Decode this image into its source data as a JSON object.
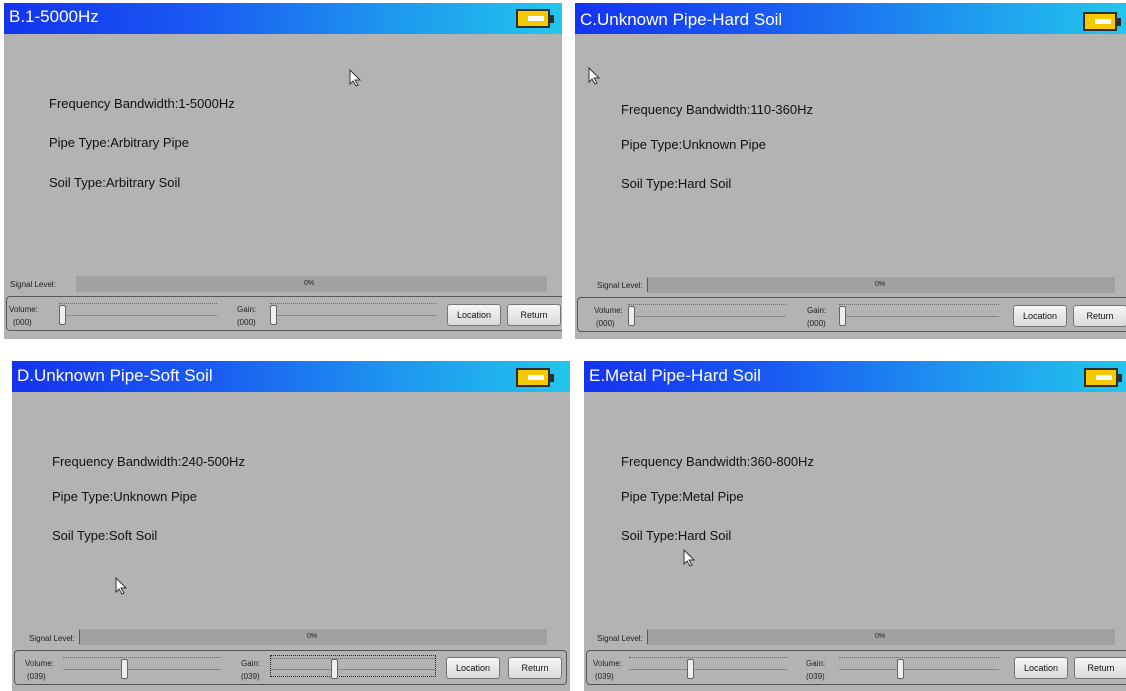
{
  "panels": [
    {
      "title": "B.1-5000Hz",
      "freq": "Frequency Bandwidth:1-5000Hz",
      "pipe": "Pipe Type:Arbitrary Pipe",
      "soil": "Soil Type:Arbitrary Soil",
      "signal_label": "Signal Level:",
      "signal_pct": "0%",
      "volume_label": "Volume:",
      "volume_value": "(000)",
      "gain_label": "Gain:",
      "gain_value": "(000)",
      "location_label": "Location",
      "return_label": "Return"
    },
    {
      "title": "C.Unknown Pipe-Hard Soil",
      "freq": "Frequency Bandwidth:110-360Hz",
      "pipe": "Pipe Type:Unknown Pipe",
      "soil": "Soil Type:Hard Soil",
      "signal_label": "Signal Level:",
      "signal_pct": "0%",
      "volume_label": "Volume:",
      "volume_value": "(000)",
      "gain_label": "Gain:",
      "gain_value": "(000)",
      "location_label": "Location",
      "return_label": "Return"
    },
    {
      "title": "D.Unknown Pipe-Soft Soil",
      "freq": "Frequency Bandwidth:240-500Hz",
      "pipe": "Pipe Type:Unknown Pipe",
      "soil": "Soil Type:Soft Soil",
      "signal_label": "Signal Level:",
      "signal_pct": "0%",
      "volume_label": "Volume:",
      "volume_value": "(039)",
      "gain_label": "Gain:",
      "gain_value": "(039)",
      "location_label": "Location",
      "return_label": "Return"
    },
    {
      "title": "E.Metal Pipe-Hard Soil",
      "freq": "Frequency Bandwidth:360-800Hz",
      "pipe": "Pipe Type:Metal Pipe",
      "soil": "Soil Type:Hard Soil",
      "signal_label": "Signal Level:",
      "signal_pct": "0%",
      "volume_label": "Volume:",
      "volume_value": "(039)",
      "gain_label": "Gain:",
      "gain_value": "(039)",
      "location_label": "Location",
      "return_label": "Return"
    }
  ],
  "colors": {
    "panel_bg": "#b3b3b3",
    "title_gradient_start": "#1433f0",
    "title_gradient_end": "#22c6ec",
    "battery": "#f5c800"
  },
  "icons": [
    "battery-icon",
    "mouse-pointer-icon"
  ]
}
